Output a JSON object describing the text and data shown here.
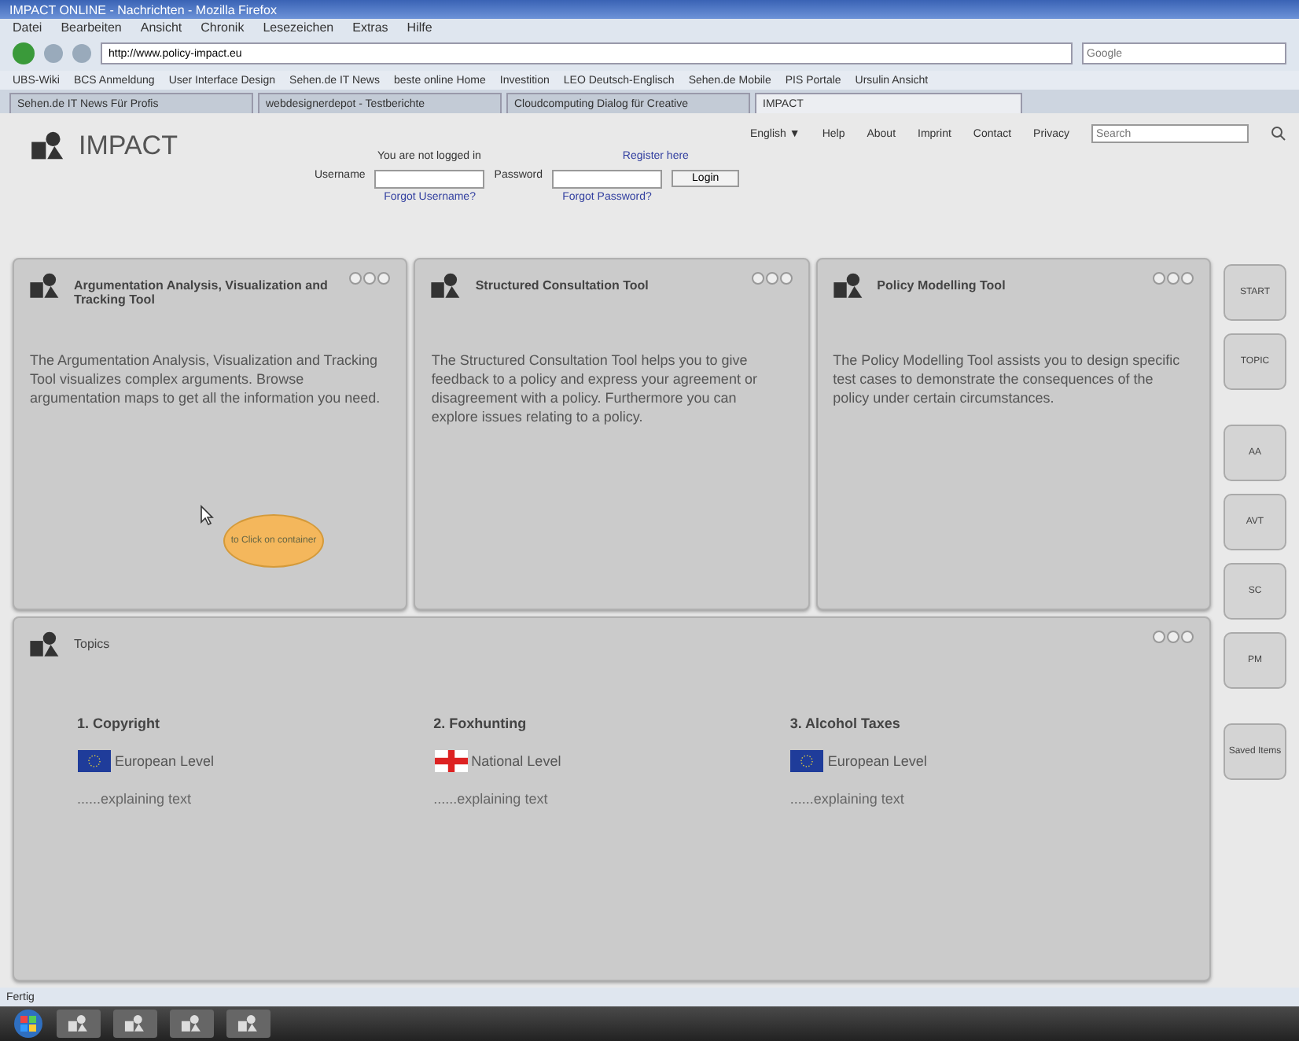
{
  "window": {
    "title": "IMPACT ONLINE - Nachrichten - Mozilla Firefox"
  },
  "menu": [
    "Datei",
    "Bearbeiten",
    "Ansicht",
    "Chronik",
    "Lesezeichen",
    "Extras",
    "Hilfe"
  ],
  "address": {
    "value": "http://www.policy-impact.eu",
    "search_placeholder": "Google"
  },
  "bookmarks": [
    "UBS-Wiki",
    "BCS Anmeldung",
    "User Interface Design",
    "Sehen.de IT News",
    "beste online Home",
    "Investition",
    "LEO Deutsch-Englisch",
    "Sehen.de Mobile",
    "PIS Portale",
    "Ursulin Ansicht"
  ],
  "tabs": [
    {
      "label": "Sehen.de IT News Für Profis",
      "selected": false
    },
    {
      "label": "webdesignerdepot - Testberichte",
      "selected": false
    },
    {
      "label": "Cloudcomputing Dialog für Creative",
      "selected": false
    },
    {
      "label": "IMPACT",
      "selected": true
    }
  ],
  "header": {
    "logo": "IMPACT",
    "links": [
      "English ▼",
      "Help",
      "About",
      "Imprint",
      "Contact",
      "Privacy"
    ],
    "search_placeholder": "Search",
    "status": "You are not logged in",
    "register": "Register here",
    "username_label": "Username",
    "password_label": "Password",
    "login": "Login",
    "forgot_username": "Forgot Username?",
    "forgot_password": "Forgot Password?"
  },
  "tools": [
    {
      "title": "Argumentation Analysis, Visualization and Tracking Tool",
      "text": "The Argumentation Analysis, Visualization and Tracking Tool visualizes complex arguments. Browse argumentation maps to get all the information you need.",
      "tooltip": "to Click on container"
    },
    {
      "title": "Structured Consultation Tool",
      "text": "The Structured Consultation Tool helps you to give feedback to a policy and express your agreement or disagreement with a policy. Furthermore you can explore issues relating to a policy."
    },
    {
      "title": "Policy Modelling Tool",
      "text": "The Policy Modelling Tool assists you to design specific test cases to demonstrate the consequences of the policy under certain circumstances."
    }
  ],
  "side_buttons": [
    "START",
    "TOPIC",
    "AA",
    "AVT",
    "SC",
    "PM",
    "Saved Items"
  ],
  "topics": {
    "title": "Topics",
    "items": [
      {
        "title": "1. Copyright",
        "kind": "eu",
        "level": "European Level",
        "note": "......explaining text"
      },
      {
        "title": "2. Foxhunting",
        "kind": "england",
        "level": "National Level",
        "note": "......explaining text"
      },
      {
        "title": "3. Alcohol Taxes",
        "kind": "eu",
        "level": "European Level",
        "note": "......explaining text"
      }
    ]
  },
  "status_bar": "Fertig"
}
